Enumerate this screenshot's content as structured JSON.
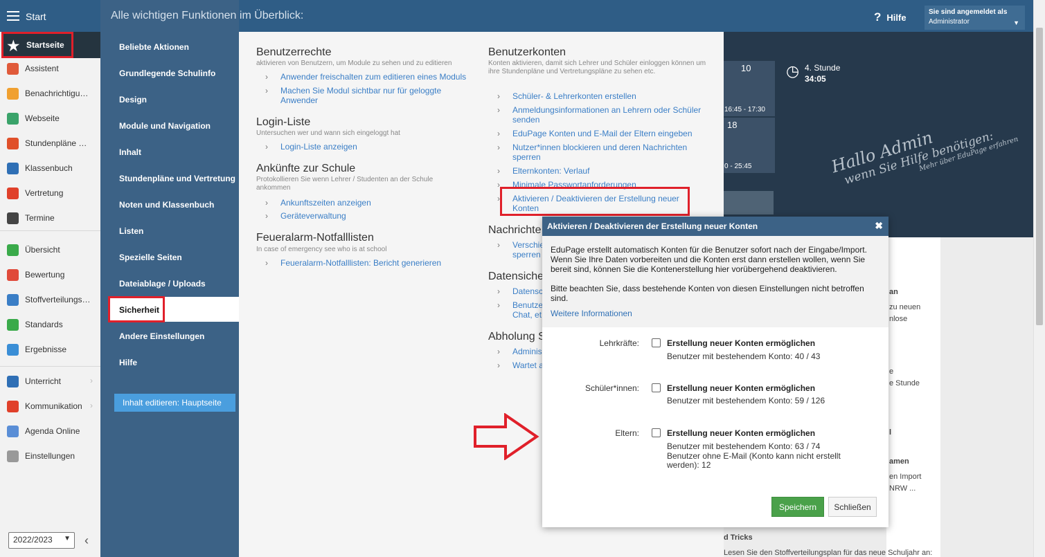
{
  "topbar": {
    "start_label": "Start",
    "help_label": "Hilfe",
    "user_line1": "Sie sind angemeldet als",
    "user_line2": "Administrator"
  },
  "sidebar": {
    "home_label": "Startseite",
    "items": [
      {
        "label": "Assistent",
        "icon": "wand-icon",
        "color": "#e05a3a"
      },
      {
        "label": "Benachrichtigungen",
        "icon": "envelope-icon",
        "color": "#f0a030"
      },
      {
        "label": "Webseite",
        "icon": "house-icon",
        "color": "#3aa36a"
      },
      {
        "label": "Stundenpläne und Vertretung",
        "icon": "calendar-icon",
        "color": "#e0502a"
      },
      {
        "label": "Klassenbuch",
        "icon": "book-icon",
        "color": "#2f6fb5"
      },
      {
        "label": "Vertretung",
        "icon": "person-icon",
        "color": "#e0402a"
      },
      {
        "label": "Termine",
        "icon": "calendar-grid-icon",
        "color": "#444444"
      },
      {
        "label": "Übersicht",
        "icon": "check-circle-icon",
        "color": "#3aaa4a"
      },
      {
        "label": "Bewertung",
        "icon": "target-icon",
        "color": "#e04a3a"
      },
      {
        "label": "Stoffverteilungsplan",
        "icon": "briefcase-icon",
        "color": "#3a7ec6"
      },
      {
        "label": "Standards",
        "icon": "shield-check-icon",
        "color": "#3aaa4a"
      },
      {
        "label": "Ergebnisse",
        "icon": "bar-chart-icon",
        "color": "#3a8ed6"
      },
      {
        "label": "Unterricht",
        "icon": "briefcase-icon",
        "color": "#2f6fb5"
      },
      {
        "label": "Kommunikation",
        "icon": "chat-icon",
        "color": "#e0402a"
      },
      {
        "label": "Agenda Online",
        "icon": "pen-icon",
        "color": "#5a8ed6"
      },
      {
        "label": "Einstellungen",
        "icon": "gear-icon",
        "color": "#999999"
      }
    ],
    "year": "2022/2023"
  },
  "overlay": {
    "title": "Alle wichtigen Funktionen im Überblick:",
    "items": [
      "Beliebte Aktionen",
      "Grundlegende Schulinfo",
      "Design",
      "Module und Navigation",
      "Inhalt",
      "Stundenpläne und Vertretung",
      "Noten und Klassenbuch",
      "Listen",
      "Spezielle Seiten",
      "Dateiablage / Uploads",
      "Sicherheit",
      "Andere Einstellungen",
      "Hilfe"
    ],
    "edit_button": "Inhalt editieren: Hauptseite"
  },
  "content": {
    "benutzerrechte": {
      "title": "Benutzerrechte",
      "desc": "aktivieren von Benutzern, um Module zu sehen und zu editieren",
      "links": [
        "Anwender freischalten zum editieren eines Moduls",
        "Machen Sie Modul sichtbar nur für geloggte Anwender"
      ]
    },
    "login": {
      "title": "Login-Liste",
      "desc": "Untersuchen wer und wann sich eingeloggt hat",
      "links": [
        "Login-Liste anzeigen"
      ]
    },
    "ankuenfte": {
      "title": "Ankünfte zur Schule",
      "desc": "Protokollieren Sie wenn Lehrer / Studenten an der Schule ankommen",
      "links": [
        "Ankunftszeiten anzeigen",
        "Geräteverwaltung"
      ]
    },
    "feueralarm": {
      "title": "Feueralarm-Notfalllisten",
      "desc": "In case of emergency see who is at school",
      "links": [
        "Feueralarm-Notfalllisten: Bericht generieren"
      ]
    },
    "konten": {
      "title": "Benutzerkonten",
      "desc": "Konten aktivieren, damit sich Lehrer und Schüler einloggen können um ihre Stundenpläne und Vertretungspläne zu sehen etc.",
      "links": [
        "Schüler- & Lehrerkonten erstellen",
        "Anmeldungsinformationen an Lehrern oder Schüler senden",
        "EduPage Konten und E-Mail der Eltern eingeben",
        "Nutzer*innen blockieren und deren Nachrichten sperren",
        "Elternkonten: Verlauf",
        "Minimale Passwortanforderungen",
        "Aktivieren / Deaktivieren der Erstellung neuer Konten"
      ]
    },
    "nachrichten": {
      "title": "Nachrichte",
      "links": [
        "Verschie",
        "sperren"
      ]
    },
    "datensicherheit": {
      "title": "Datensiche",
      "links": [
        "Datensc",
        "Benutze",
        "Chat, et"
      ]
    },
    "abholung": {
      "title": "Abholung S",
      "links": [
        "Adminis",
        "Wartet a"
      ]
    }
  },
  "dashboard": {
    "tile_10": "10",
    "tile_10_time": "16:45 - 17:30",
    "tile_18": "18",
    "tile_18_time": "0 - 25:45",
    "stunde_label": "4. Stunde",
    "stunde_time": "34:05",
    "hallo_line1": "Hallo Admin",
    "hallo_line2": "wenn Sie Hilfe benötigen:",
    "hallo_line3": "Mehr über EduPage erfahren",
    "cut_texts": [
      "an",
      "zu neuen",
      "nlose",
      "e",
      "e Stunde",
      "l",
      "amen",
      "en Import",
      "NRW ...",
      "d Tricks",
      "Lesen Sie den Stoffverteilungsplan für das neue Schuljahr an:"
    ]
  },
  "modal": {
    "title": "Aktivieren / Deaktivieren der Erstellung neuer Konten",
    "info_p1": "EduPage erstellt automatisch Konten für die Benutzer sofort nach der Eingabe/Import. Wenn Sie Ihre Daten vorbereiten und die Konten erst dann erstellen wollen, wenn Sie bereit sind, können Sie die Kontenerstellung hier vorübergehend deaktivieren.",
    "info_p2": "Bitte beachten Sie, dass bestehende Konten von diesen Einstellungen nicht betroffen sind.",
    "more_link": "Weitere Informationen",
    "options": [
      {
        "label": "Lehrkräfte:",
        "title": "Erstellung neuer Konten ermöglichen",
        "sub": "Benutzer mit bestehendem Konto: 40 / 43",
        "sub2": ""
      },
      {
        "label": "Schüler*innen:",
        "title": "Erstellung neuer Konten ermöglichen",
        "sub": "Benutzer mit bestehendem Konto: 59 / 126",
        "sub2": ""
      },
      {
        "label": "Eltern:",
        "title": "Erstellung neuer Konten ermöglichen",
        "sub": "Benutzer mit bestehendem Konto: 63 / 74",
        "sub2": "Benutzer ohne E-Mail (Konto kann nicht erstellt werden): 12"
      }
    ],
    "save": "Speichern",
    "close": "Schließen"
  },
  "colors": {
    "topbar": "#2f5d86",
    "overlay": "#3c6286",
    "link": "#3a7ec6",
    "annotation": "#e0202a",
    "save": "#4aa14a"
  }
}
